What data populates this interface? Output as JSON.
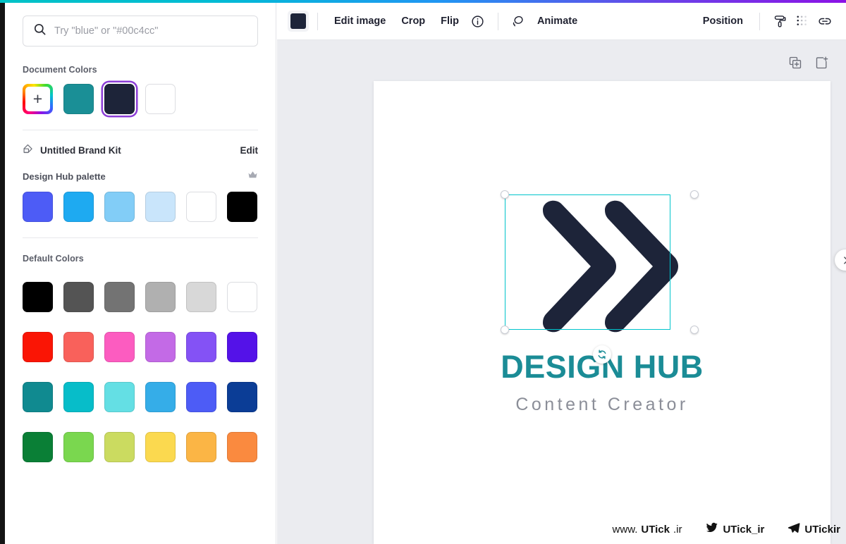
{
  "theme": {
    "accent_cyan": "#00c4cc",
    "selection_purple": "#8b3dd6",
    "canvas_bg": "#ebecf0",
    "brand_teal": "#1b8c96",
    "brand_navy": "#1d2439"
  },
  "search": {
    "placeholder": "Try \"blue\" or \"#00c4cc\"",
    "value": "",
    "icon": "search-icon"
  },
  "document_colors": {
    "label": "Document Colors",
    "add_icon": "plus-icon",
    "swatches": [
      {
        "name": "teal",
        "hex": "#1a8f96",
        "selected": false
      },
      {
        "name": "navy",
        "hex": "#1d2439",
        "selected": true
      },
      {
        "name": "white",
        "hex": "#ffffff",
        "selected": false
      }
    ]
  },
  "brand_kit": {
    "icon": "brand-kit-icon",
    "name": "Untitled Brand Kit",
    "edit_label": "Edit",
    "palette_title": "Design Hub palette",
    "premium_icon": "crown-icon",
    "palette": [
      {
        "name": "indigo",
        "hex": "#4d5cf6"
      },
      {
        "name": "blue",
        "hex": "#1eaaf1"
      },
      {
        "name": "sky",
        "hex": "#82cdf7"
      },
      {
        "name": "pale-blue",
        "hex": "#c9e5fb"
      },
      {
        "name": "white",
        "hex": "#ffffff"
      },
      {
        "name": "black",
        "hex": "#000000"
      }
    ]
  },
  "default_colors": {
    "label": "Default Colors",
    "rows": [
      [
        {
          "name": "black",
          "hex": "#000000"
        },
        {
          "name": "dark-gray",
          "hex": "#545454"
        },
        {
          "name": "gray",
          "hex": "#737373"
        },
        {
          "name": "light-gray",
          "hex": "#b0b0b0"
        },
        {
          "name": "pale-gray",
          "hex": "#d8d8d8"
        },
        {
          "name": "white",
          "hex": "#ffffff"
        }
      ],
      [
        {
          "name": "red",
          "hex": "#fa1505"
        },
        {
          "name": "salmon",
          "hex": "#f9615b"
        },
        {
          "name": "pink",
          "hex": "#fc5cc0"
        },
        {
          "name": "orchid",
          "hex": "#c36ae6"
        },
        {
          "name": "violet",
          "hex": "#8452f5"
        },
        {
          "name": "purple",
          "hex": "#5412e8"
        }
      ],
      [
        {
          "name": "teal",
          "hex": "#108a90"
        },
        {
          "name": "cyan",
          "hex": "#07bdc9"
        },
        {
          "name": "aqua",
          "hex": "#64dfe4"
        },
        {
          "name": "sky-blue",
          "hex": "#35ade8"
        },
        {
          "name": "royal-blue",
          "hex": "#4d5cf6"
        },
        {
          "name": "navy-blue",
          "hex": "#0b3d96"
        }
      ],
      [
        {
          "name": "green",
          "hex": "#0a7f36"
        },
        {
          "name": "light-green",
          "hex": "#7ad74f"
        },
        {
          "name": "lime",
          "hex": "#cbdb60"
        },
        {
          "name": "yellow",
          "hex": "#fbd94f"
        },
        {
          "name": "amber",
          "hex": "#fbb545"
        },
        {
          "name": "orange",
          "hex": "#fa8a3f"
        }
      ]
    ]
  },
  "toolbar": {
    "selected_color_hex": "#1d2439",
    "edit_image_label": "Edit image",
    "crop_label": "Crop",
    "flip_label": "Flip",
    "info_icon": "info-icon",
    "animate_icon": "animate-icon",
    "animate_label": "Animate",
    "position_label": "Position",
    "paint_roller_icon": "paint-roller-icon",
    "transparency_icon": "transparency-dots-icon",
    "link_icon": "link-icon"
  },
  "canvas": {
    "duplicate_page_icon": "duplicate-page-icon",
    "add_page_icon": "add-page-icon",
    "edge_button_icon": "chevron-right-icon",
    "rotate_icon": "rotate-handle-icon",
    "selection": {
      "element_name": "double-chevron-logo-mark",
      "handles": [
        "top-left",
        "top-right",
        "bottom-left",
        "bottom-right"
      ]
    },
    "logo": {
      "wordmark": "DESIGN HUB",
      "tagline": "Content Creator"
    }
  },
  "watermarks": [
    {
      "name": "website",
      "prefix": "www.",
      "bold": "UTick",
      "suffix": ".ir",
      "icon": null
    },
    {
      "name": "twitter",
      "text": "UTick_ir",
      "icon": "twitter-bird-icon"
    },
    {
      "name": "telegram",
      "text": "UTickir",
      "icon": "telegram-plane-icon"
    }
  ]
}
